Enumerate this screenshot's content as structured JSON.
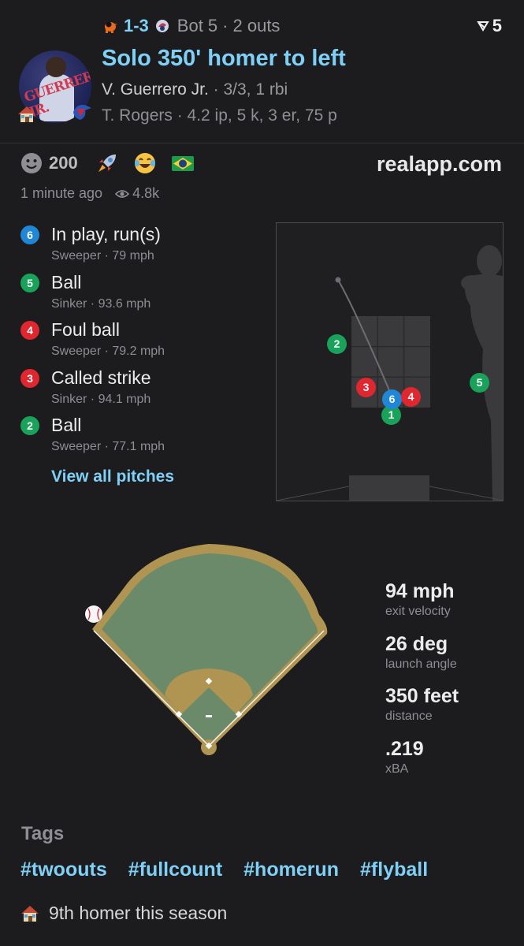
{
  "header": {
    "score": "1-3",
    "inning": "Bot 5",
    "outs": "2 outs",
    "rank": "5",
    "headline": "Solo 350' homer to left",
    "batter_name": "V. Guerrero Jr.",
    "batter_stat": "3/3, 1 rbi",
    "pitcher_line": "T. Rogers · 4.2 ip, 5 k, 3 er, 75 p",
    "avatar_text": "GUERRERO JR."
  },
  "reactions": {
    "count": "200",
    "brand": "realapp.com",
    "time": "1 minute ago",
    "views": "4.8k",
    "emojis": [
      "smile-icon",
      "rocket-icon",
      "laugh-cry-icon",
      "brazil-flag-icon"
    ]
  },
  "pitches": [
    {
      "num": "6",
      "result": "In play, run(s)",
      "detail": "Sweeper · 79 mph",
      "color": "#1f87d6"
    },
    {
      "num": "5",
      "result": "Ball",
      "detail": "Sinker · 93.6 mph",
      "color": "#19a35a"
    },
    {
      "num": "4",
      "result": "Foul ball",
      "detail": "Sweeper · 79.2 mph",
      "color": "#e0262e"
    },
    {
      "num": "3",
      "result": "Called strike",
      "detail": "Sinker · 94.1 mph",
      "color": "#e0262e"
    },
    {
      "num": "2",
      "result": "Ball",
      "detail": "Sweeper · 77.1 mph",
      "color": "#19a35a"
    }
  ],
  "view_all": "View all pitches",
  "zone_markers": [
    {
      "num": "2",
      "color": "#19a35a"
    },
    {
      "num": "3",
      "color": "#e0262e"
    },
    {
      "num": "6",
      "color": "#1f87d6"
    },
    {
      "num": "4",
      "color": "#e0262e"
    },
    {
      "num": "1",
      "color": "#19a35a"
    },
    {
      "num": "5",
      "color": "#19a35a"
    }
  ],
  "hit_stats": [
    {
      "value": "94 mph",
      "label": "exit velocity"
    },
    {
      "value": "26 deg",
      "label": "launch angle"
    },
    {
      "value": "350 feet",
      "label": "distance"
    },
    {
      "value": ".219",
      "label": "xBA"
    }
  ],
  "tags_title": "Tags",
  "tags": [
    "#twoouts",
    "#fullcount",
    "#homerun",
    "#flyball"
  ],
  "footnote": "9th homer this season",
  "colors": {
    "accent": "#7fd0f6",
    "background": "#1c1c1e",
    "field_grass": "#6b8a6a",
    "field_dirt": "#b09452"
  }
}
